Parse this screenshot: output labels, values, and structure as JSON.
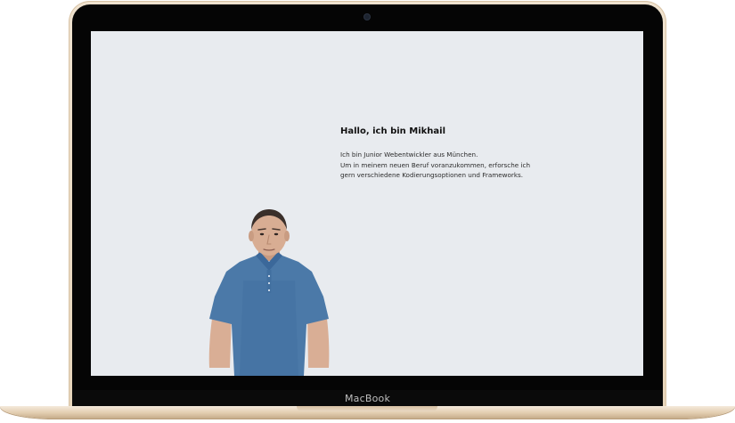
{
  "device": {
    "brand_label": "MacBook"
  },
  "page": {
    "heading": "Hallo, ich bin Mikhail",
    "intro_lines": [
      "Ich bin Junior Webentwickler aus München.",
      "Um in meinem neuen Beruf voranzukommen, erforsche ich",
      "gern verschiedene Kodierungsoptionen und Frameworks."
    ],
    "background_color": "#e8ebef"
  },
  "portrait": {
    "shirt_color": "#4b79a8"
  }
}
